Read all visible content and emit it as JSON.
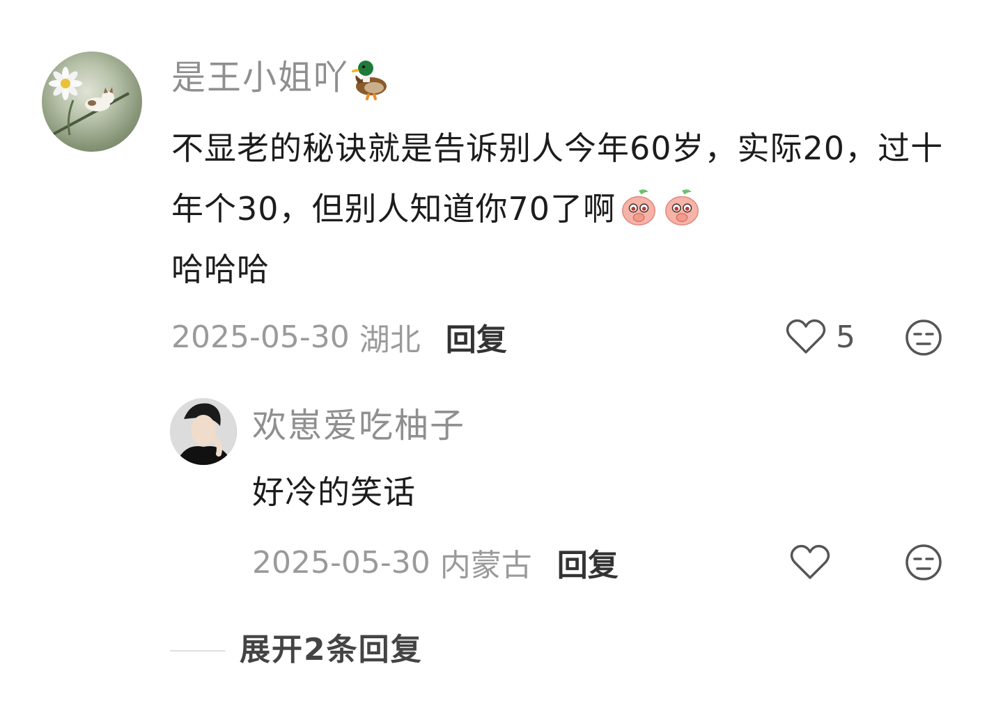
{
  "comment": {
    "username": "是王小姐吖",
    "username_emoji": "duck-icon",
    "text_before_emoji": "不显老的秘诀就是告诉别人今年60岁，实际20，过十年个30，但别人知道你70了啊",
    "text_emojis": [
      "blushing-face-icon",
      "blushing-face-icon"
    ],
    "text_after_emoji": "哈哈哈",
    "date": "2025-05-30",
    "location": "湖北",
    "reply_label": "回复",
    "like_count": "5",
    "like_icon": "heart-icon",
    "dislike_icon": "unamused-face-icon"
  },
  "reply": {
    "username": "欢崽爱吃柚子",
    "text": "好冷的笑话",
    "date": "2025-05-30",
    "location": "内蒙古",
    "reply_label": "回复",
    "like_icon": "heart-icon",
    "dislike_icon": "unamused-face-icon"
  },
  "expand": {
    "label": "展开2条回复"
  },
  "colors": {
    "text_primary": "#1c1c1c",
    "text_secondary": "#8f8f8f",
    "text_meta": "#9a9a9a",
    "icon_gray": "#555555",
    "emoji_pink": "#f7b3a8"
  }
}
